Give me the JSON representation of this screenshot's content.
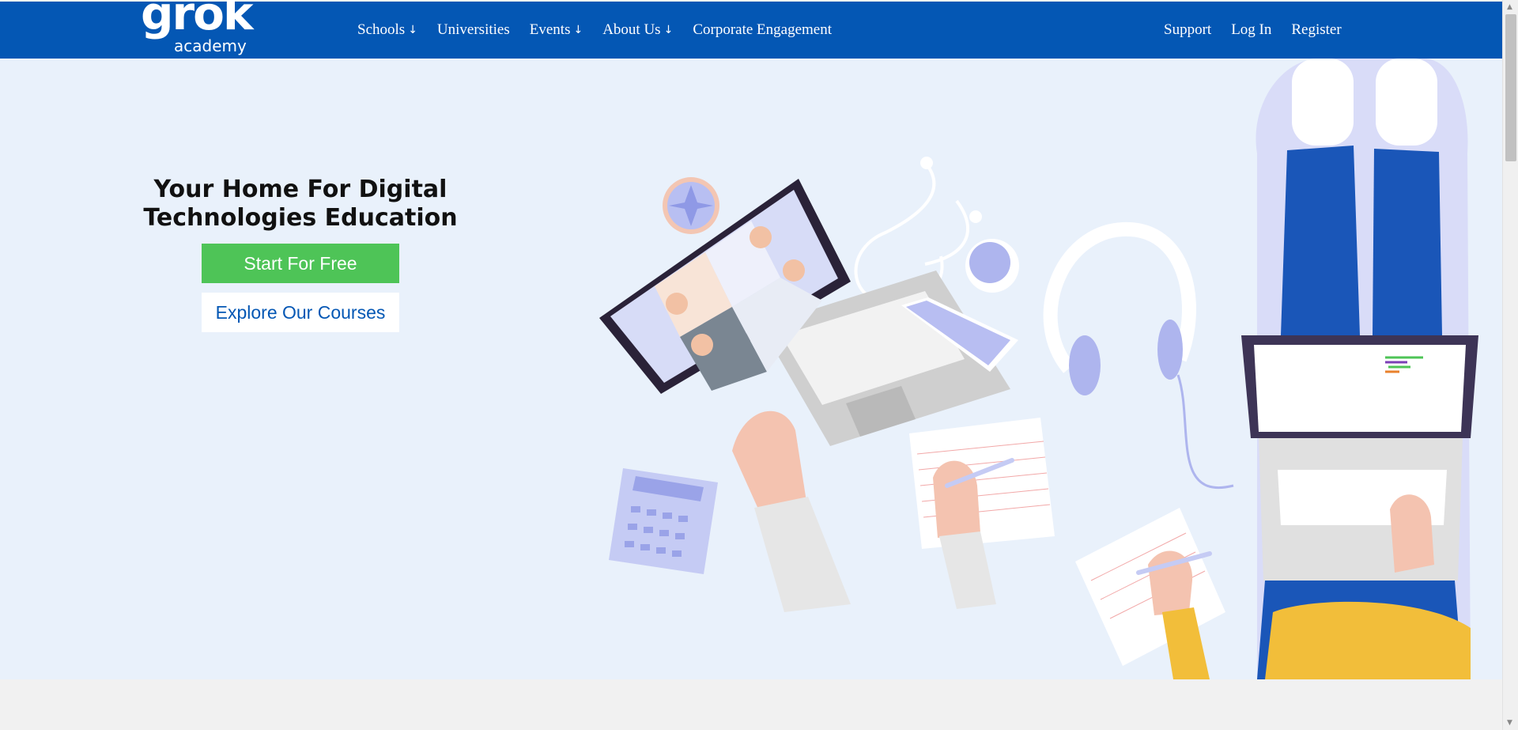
{
  "brand": {
    "logo_word": "grok",
    "logo_sub": "academy"
  },
  "nav": {
    "left": [
      {
        "label": "Schools",
        "has_arrow": true
      },
      {
        "label": "Universities",
        "has_arrow": false
      },
      {
        "label": "Events",
        "has_arrow": true
      },
      {
        "label": "About Us",
        "has_arrow": true
      },
      {
        "label": "Corporate Engagement",
        "has_arrow": false
      }
    ],
    "arrow_glyph": "↓",
    "right": [
      {
        "label": "Support"
      },
      {
        "label": "Log In"
      },
      {
        "label": "Register"
      }
    ]
  },
  "hero": {
    "headline_line1": "Your Home For Digital",
    "headline_line2": "Technologies Education",
    "primary_button": "Start For Free",
    "secondary_button": "Explore Our Courses"
  },
  "colors": {
    "header_bg": "#0457b4",
    "hero_bg": "#e9f1fb",
    "cta_green": "#4ec457",
    "link_blue": "#0457b4"
  },
  "icons": {
    "nav_dropdown": "arrow-down-icon",
    "illustration": "students-studying-illustration"
  }
}
